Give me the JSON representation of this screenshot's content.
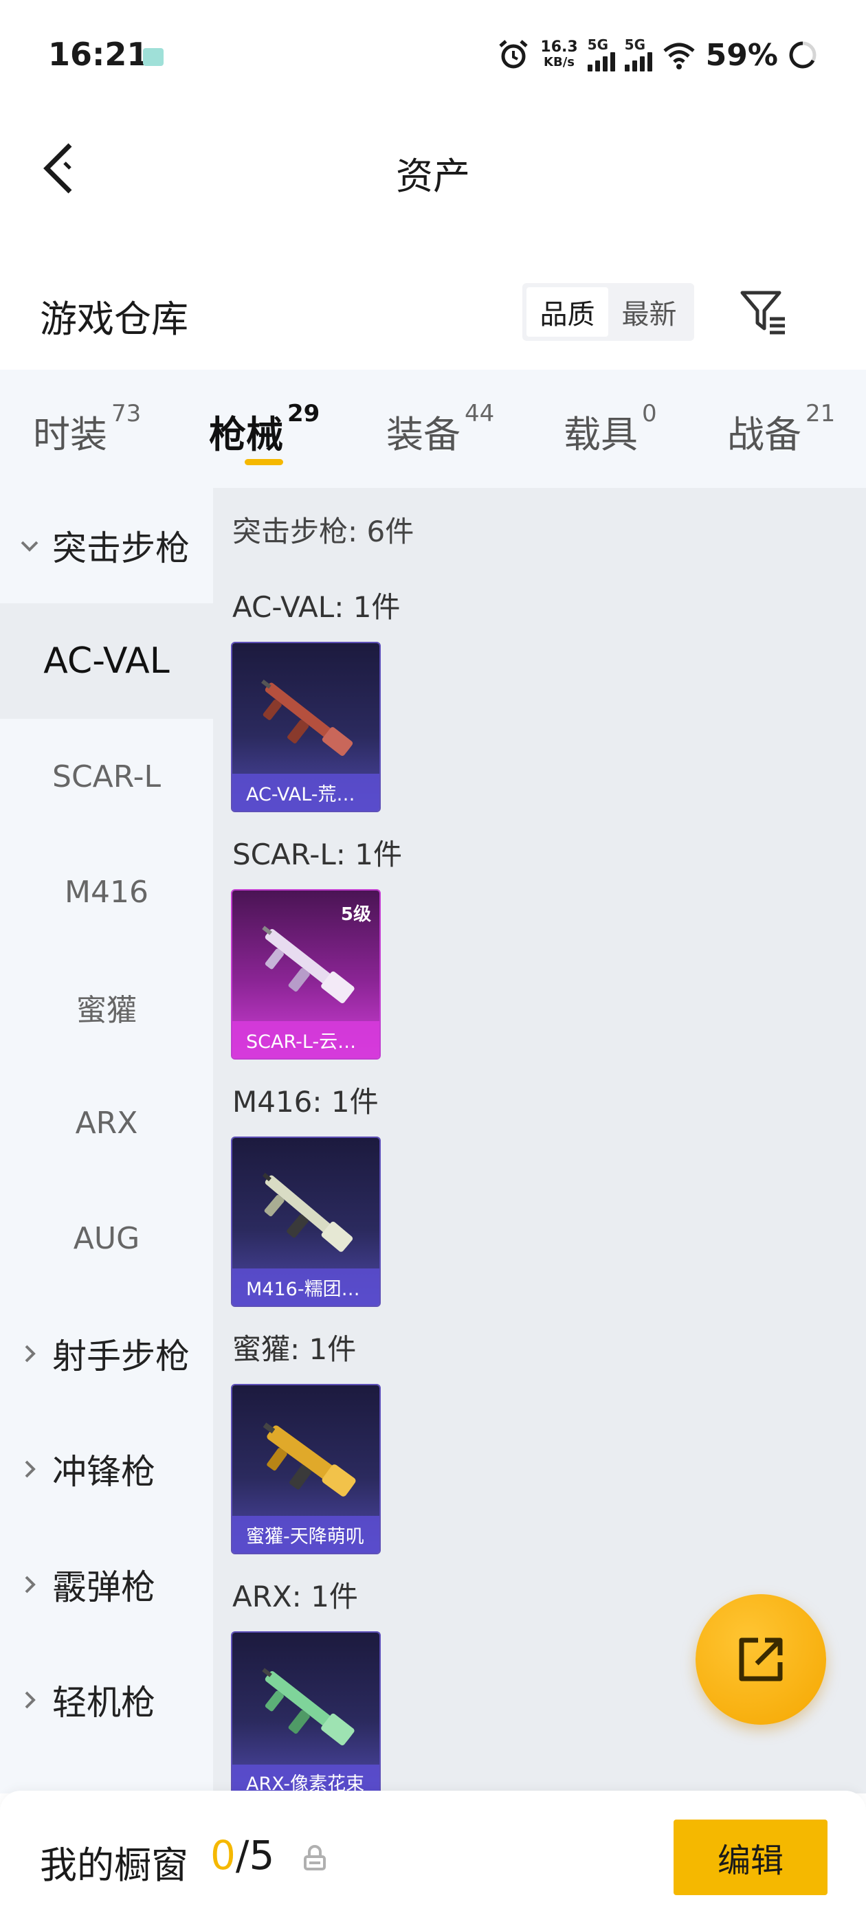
{
  "status_bar": {
    "time": "16:21",
    "net_speed_value": "16.3",
    "net_speed_unit": "KB/s",
    "signal_1_label": "5G",
    "signal_2_label": "5G",
    "battery_pct": "59%"
  },
  "header": {
    "title": "资产"
  },
  "warehouse": {
    "title": "游戏仓库",
    "sort_options": [
      "品质",
      "最新"
    ],
    "active_sort": "品质"
  },
  "tabs": [
    {
      "label": "时装",
      "count": "73"
    },
    {
      "label": "枪械",
      "count": "29"
    },
    {
      "label": "装备",
      "count": "44"
    },
    {
      "label": "载具",
      "count": "0"
    },
    {
      "label": "战备",
      "count": "21"
    }
  ],
  "active_tab": "枪械",
  "sidebar": {
    "groups": [
      {
        "label": "突击步枪",
        "expanded": true
      },
      {
        "label": "射手步枪",
        "expanded": false
      },
      {
        "label": "冲锋枪",
        "expanded": false
      },
      {
        "label": "霰弹枪",
        "expanded": false
      },
      {
        "label": "轻机枪",
        "expanded": false
      }
    ],
    "items": [
      "AC-VAL",
      "SCAR-L",
      "M416",
      "蜜獾",
      "ARX",
      "AUG"
    ],
    "active_item": "AC-VAL"
  },
  "content": {
    "heading": "突击步枪: 6件",
    "groups": [
      {
        "label": "AC-VAL: 1件",
        "skin_name": "AC-VAL-荒…",
        "level": "",
        "style": "purple",
        "gun_color": "#b5503e"
      },
      {
        "label": "SCAR-L: 1件",
        "skin_name": "SCAR-L-云…",
        "level": "5级",
        "style": "pink",
        "gun_color": "#e8dcf0"
      },
      {
        "label": "M416: 1件",
        "skin_name": "M416-糯团…",
        "level": "",
        "style": "purple",
        "gun_color": "#d9dcc4"
      },
      {
        "label": "蜜獾: 1件",
        "skin_name": "蜜獾-天降萌叽",
        "level": "",
        "style": "purple",
        "gun_color": "#e0a92a"
      },
      {
        "label": "ARX: 1件",
        "skin_name": "ARX-像素花束",
        "level": "",
        "style": "purple",
        "gun_color": "#7fd49a"
      }
    ]
  },
  "bottom_bar": {
    "showcase_label": "我的橱窗",
    "showcase_current": "0",
    "showcase_total": "/5",
    "edit_label": "编辑"
  },
  "icons": {
    "back": "chevron-left-icon",
    "filter": "filter-icon",
    "share": "share-external-icon",
    "lock": "lock-icon"
  },
  "colors": {
    "accent": "#f5b800",
    "card_purple": "#4e48a8",
    "card_pink": "#d13fd8"
  }
}
